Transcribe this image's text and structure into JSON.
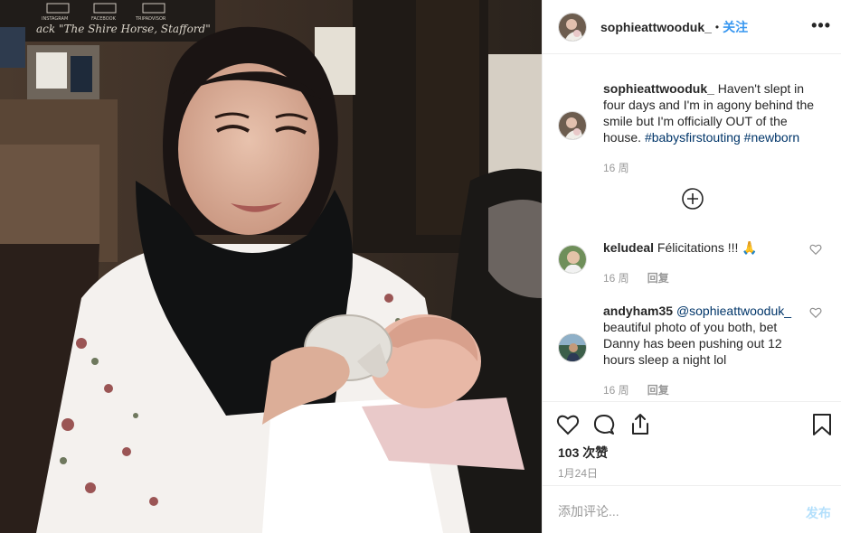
{
  "post": {
    "username": "sophieattwooduk_",
    "separator": "•",
    "follow_label": "关注",
    "more_label": "•••",
    "photo_sign_text": "ack \"The Shire Horse, Stafford\"",
    "photo_logos": [
      "INSTAGRAM",
      "FACEBOOK",
      "TRIPADVISOR"
    ]
  },
  "caption": {
    "username": "sophieattwooduk_",
    "text": " Haven't slept in four days and I'm in agony behind the smile but I'm officially OUT of the house. ",
    "hashtag_1": "#babysfirstouting",
    "hashtag_2": "#newborn",
    "time": "16 周"
  },
  "load_more_icon": "plus-circle-icon",
  "comments": [
    {
      "username": "keludeal",
      "text": " Félicitations !!! 🙏",
      "time": "16 周",
      "reply": "回复"
    },
    {
      "username": "andyham35",
      "mention": "@sophieattwooduk_",
      "text": " beautiful photo of you both, bet Danny has been pushing out 12 hours sleep a night lol",
      "time": "16 周",
      "reply": "回复"
    }
  ],
  "actions": {
    "icons": [
      "heart-icon",
      "comment-icon",
      "share-icon",
      "bookmark-icon"
    ],
    "likes": "103 次赞",
    "date": "1月24日"
  },
  "composer": {
    "placeholder": "添加评论...",
    "post_label": "发布"
  },
  "colors": {
    "link_blue": "#3897f0",
    "hashtag": "#003569",
    "muted": "#999999",
    "post_disabled": "#b2dffc",
    "divider": "#efefef"
  }
}
